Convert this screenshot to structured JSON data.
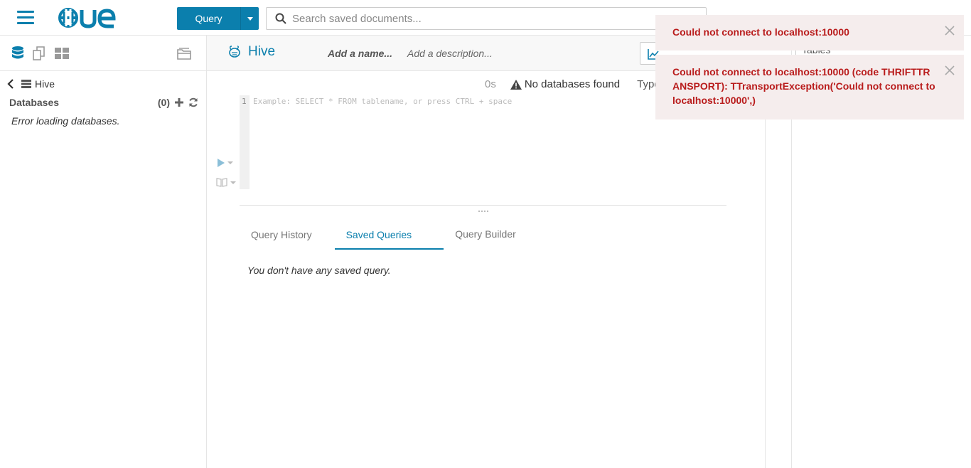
{
  "topbar": {
    "query_label": "Query",
    "search_placeholder": "Search saved documents..."
  },
  "left": {
    "breadcrumb": "Hive",
    "databases_title": "Databases",
    "databases_count": "(0)",
    "error": "Error loading databases."
  },
  "editor": {
    "title": "Hive",
    "add_name": "Add a name...",
    "add_description": "Add a description...",
    "elapsed": "0s",
    "no_databases": "No databases found",
    "type_label": "Type",
    "line_number": "1",
    "placeholder": "Example: SELECT * FROM tablename, or press CTRL + space"
  },
  "right": {
    "tables_label": "Tables"
  },
  "tabs": [
    {
      "label": "Query History"
    },
    {
      "label": "Saved Queries"
    },
    {
      "label": "Query Builder"
    }
  ],
  "no_saved": "You don't have any saved query.",
  "notifications": [
    {
      "text": "Could not connect to localhost:10000"
    },
    {
      "text": "Could not connect to localhost:10000 (code THRIFTTRANSPORT): TTransportException('Could not connect to localhost:10000',)"
    }
  ],
  "colors": {
    "accent": "#0b7fad",
    "error": "#b91c1c"
  }
}
